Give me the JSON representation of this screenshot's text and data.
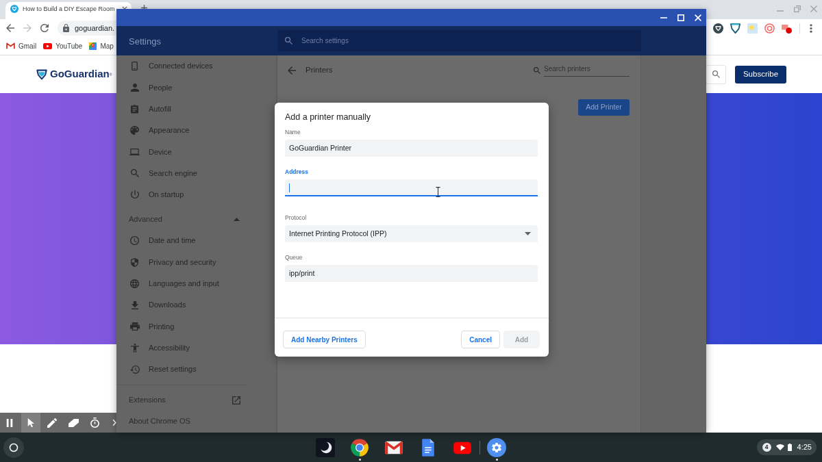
{
  "browser": {
    "tab": {
      "title": "How to Build a DIY Escape Room",
      "selected": true
    },
    "nav_buttons": [
      {
        "kind": "back",
        "disabled": false
      },
      {
        "kind": "forward",
        "disabled": true
      },
      {
        "kind": "reload",
        "disabled": false
      }
    ],
    "address": "goguardian.",
    "bookmarks": [
      {
        "label": "Gmail"
      },
      {
        "label": "YouTube"
      },
      {
        "label": "Map"
      }
    ],
    "page": {
      "logo": "GoGuardian$^{®}$",
      "subscribe": "Subscribe"
    }
  },
  "recorder_toolbar": {
    "tools": [
      {
        "kind": "pause",
        "selected": false
      },
      {
        "kind": "pointer",
        "selected": true
      },
      {
        "kind": "pen",
        "selected": false
      },
      {
        "kind": "highlighter",
        "selected": false
      },
      {
        "kind": "timer",
        "selected": false
      }
    ]
  },
  "settings": {
    "title": "Settings",
    "search": {
      "placeholder": "Search settings"
    },
    "sidebar": {
      "items": [
        {
          "label": "Connected devices"
        },
        {
          "label": "People"
        },
        {
          "label": "Autofill"
        },
        {
          "label": "Appearance"
        },
        {
          "label": "Device"
        },
        {
          "label": "Search engine"
        },
        {
          "label": "On startup"
        }
      ],
      "advanced": {
        "label": "Advanced",
        "expanded": true,
        "items": [
          {
            "label": "Date and time"
          },
          {
            "label": "Privacy and security"
          },
          {
            "label": "Languages and input"
          },
          {
            "label": "Downloads"
          },
          {
            "label": "Printing"
          },
          {
            "label": "Accessibility"
          },
          {
            "label": "Reset settings"
          }
        ]
      },
      "links": [
        {
          "label": "Extensions",
          "kind": "external"
        },
        {
          "label": "About Chrome OS",
          "kind": "internal"
        }
      ]
    },
    "page": {
      "title": "Printers",
      "search": {
        "placeholder": "Search printers"
      },
      "add_button": "Add Printer"
    }
  },
  "dialog": {
    "title": "Add a printer manually",
    "fields": [
      {
        "kind": "text",
        "label": "Name",
        "value": "GoGuardian Printer",
        "focused": false
      },
      {
        "kind": "text",
        "label": "Address",
        "focused": true
      },
      {
        "kind": "select",
        "label": "Protocol",
        "value": "Internet Printing Protocol (IPP)",
        "focused": false
      },
      {
        "kind": "text",
        "label": "Queue",
        "value": "ipp/print",
        "focused": false
      }
    ],
    "buttons": [
      {
        "label": "Add Nearby Printers",
        "disabled": false
      },
      {
        "label": "Cancel",
        "disabled": false
      },
      {
        "label": "Add",
        "disabled": true
      }
    ]
  },
  "taskbar": {
    "apps": [
      {
        "running": false
      },
      {
        "running": true
      },
      {
        "running": false
      },
      {
        "running": false
      },
      {
        "running": false
      },
      {
        "running": true
      }
    ],
    "notifications": "4",
    "time": "4:25"
  }
}
